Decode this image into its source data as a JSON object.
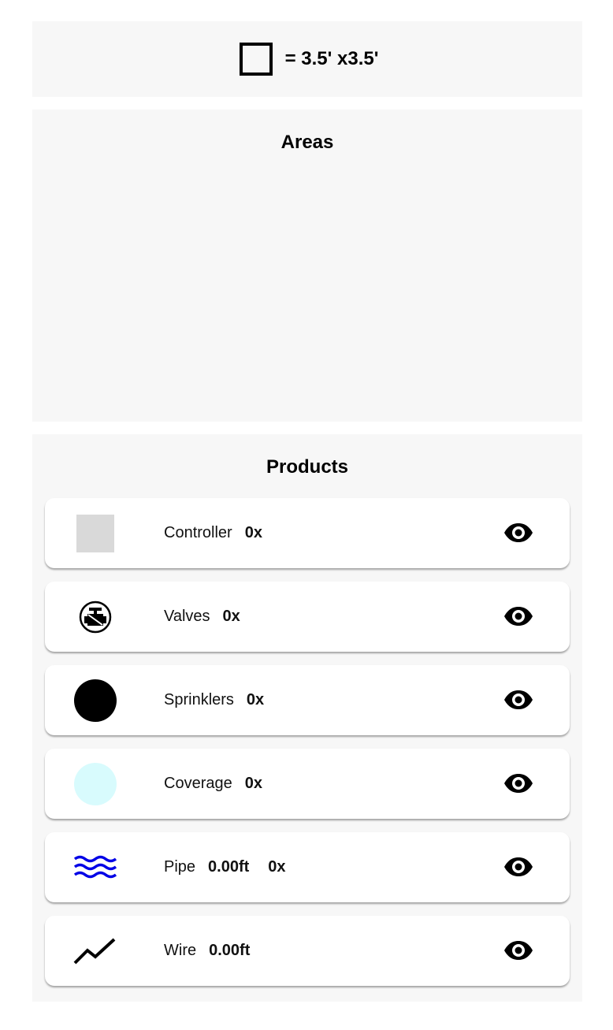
{
  "scale": {
    "label": "= 3.5' x3.5'"
  },
  "areas": {
    "title": "Areas"
  },
  "products": {
    "title": "Products",
    "items": [
      {
        "label": "Controller",
        "count": "0x",
        "icon": "controller-icon",
        "color": "#d9d9d9"
      },
      {
        "label": "Valves",
        "count": "0x",
        "icon": "valve-icon",
        "color": "#000000"
      },
      {
        "label": "Sprinklers",
        "count": "0x",
        "icon": "sprinkler-icon",
        "color": "#000000"
      },
      {
        "label": "Coverage",
        "count": "0x",
        "icon": "coverage-icon",
        "color": "#d8fbfd"
      },
      {
        "label": "Pipe",
        "length": "0.00ft",
        "count": "0x",
        "icon": "pipe-icon",
        "color": "#0000e6"
      },
      {
        "label": "Wire",
        "length": "0.00ft",
        "icon": "wire-icon",
        "color": "#000000"
      }
    ]
  }
}
